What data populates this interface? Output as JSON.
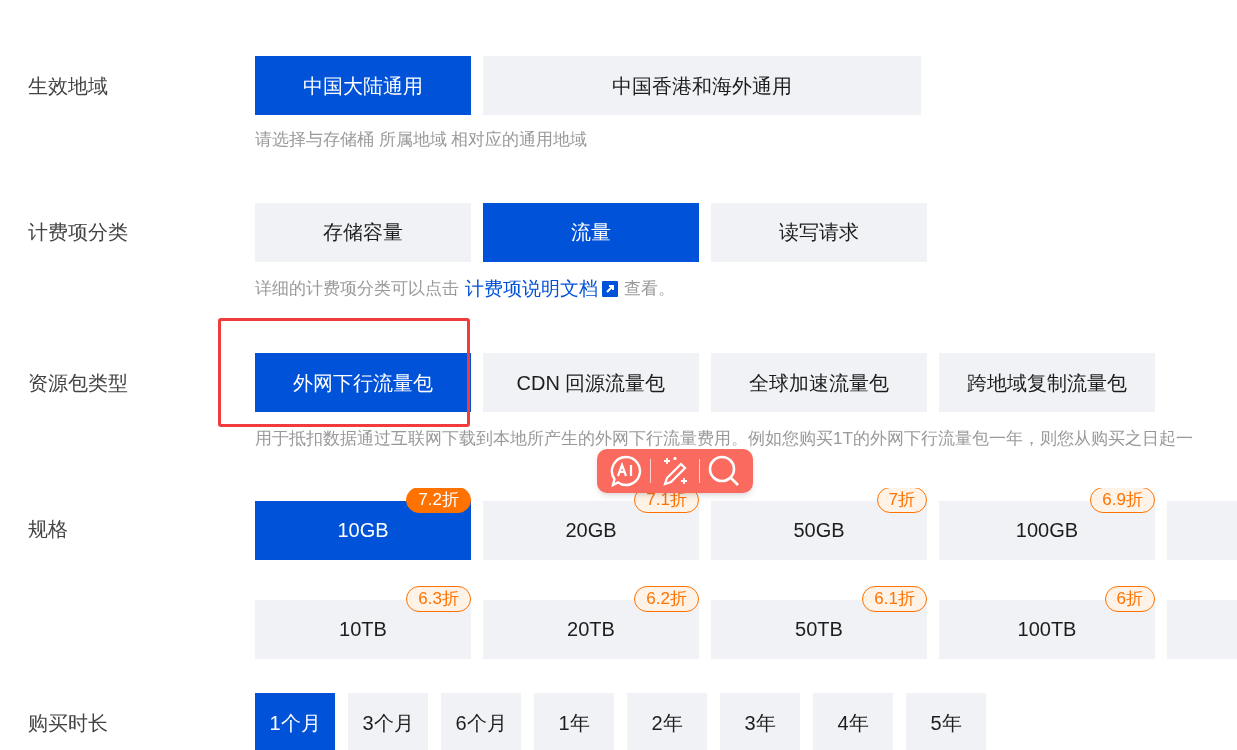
{
  "sections": [
    {
      "label": "生效地域",
      "kind": "wide",
      "options": [
        {
          "text": "中国大陆通用",
          "selected": true
        },
        {
          "text": "中国香港和海外通用",
          "selected": false
        }
      ],
      "hint": "请选择与存储桶 所属地域 相对应的通用地域"
    },
    {
      "label": "计费项分类",
      "kind": "normal",
      "options": [
        {
          "text": "存储容量",
          "selected": false
        },
        {
          "text": "流量",
          "selected": true
        },
        {
          "text": "读写请求",
          "selected": false
        }
      ],
      "hint_parts": [
        {
          "kind": "text",
          "text": "详细的计费项分类可以点击"
        },
        {
          "kind": "link",
          "text": "计费项说明文档"
        },
        {
          "kind": "text",
          "text": "查看。"
        }
      ]
    },
    {
      "label": "资源包类型",
      "kind": "normal",
      "options": [
        {
          "text": "外网下行流量包",
          "selected": true
        },
        {
          "text": "CDN 回源流量包",
          "selected": false
        },
        {
          "text": "全球加速流量包",
          "selected": false
        },
        {
          "text": "跨地域复制流量包",
          "selected": false
        }
      ],
      "hint": "用于抵扣数据通过互联网下载到本地所产生的外网下行流量费用。例如您购买1T的外网下行流量包一年，则您从购买之日起一"
    },
    {
      "label": "规格",
      "kind": "spec",
      "rows": [
        [
          {
            "text": "10GB",
            "badge": "7.2折",
            "selected": true
          },
          {
            "text": "20GB",
            "badge": "7.1折",
            "selected": false
          },
          {
            "text": "50GB",
            "badge": "7折",
            "selected": false
          },
          {
            "text": "100GB",
            "badge": "6.9折",
            "selected": false
          }
        ],
        [
          {
            "text": "10TB",
            "badge": "6.3折",
            "selected": false
          },
          {
            "text": "20TB",
            "badge": "6.2折",
            "selected": false
          },
          {
            "text": "50TB",
            "badge": "6.1折",
            "selected": false
          },
          {
            "text": "100TB",
            "badge": "6折",
            "selected": false
          }
        ]
      ]
    },
    {
      "label": "购买时长",
      "kind": "small",
      "options": [
        {
          "text": "1个月",
          "selected": true
        },
        {
          "text": "3个月",
          "selected": false
        },
        {
          "text": "6个月",
          "selected": false
        },
        {
          "text": "1年",
          "selected": false
        },
        {
          "text": "2年",
          "selected": false
        },
        {
          "text": "3年",
          "selected": false
        },
        {
          "text": "4年",
          "selected": false
        },
        {
          "text": "5年",
          "selected": false
        }
      ]
    }
  ],
  "annotation": {
    "kind": "red_box"
  },
  "toolbar": {
    "buttons": [
      {
        "kind": "ai"
      },
      {
        "kind": "wand"
      },
      {
        "kind": "search"
      }
    ]
  }
}
